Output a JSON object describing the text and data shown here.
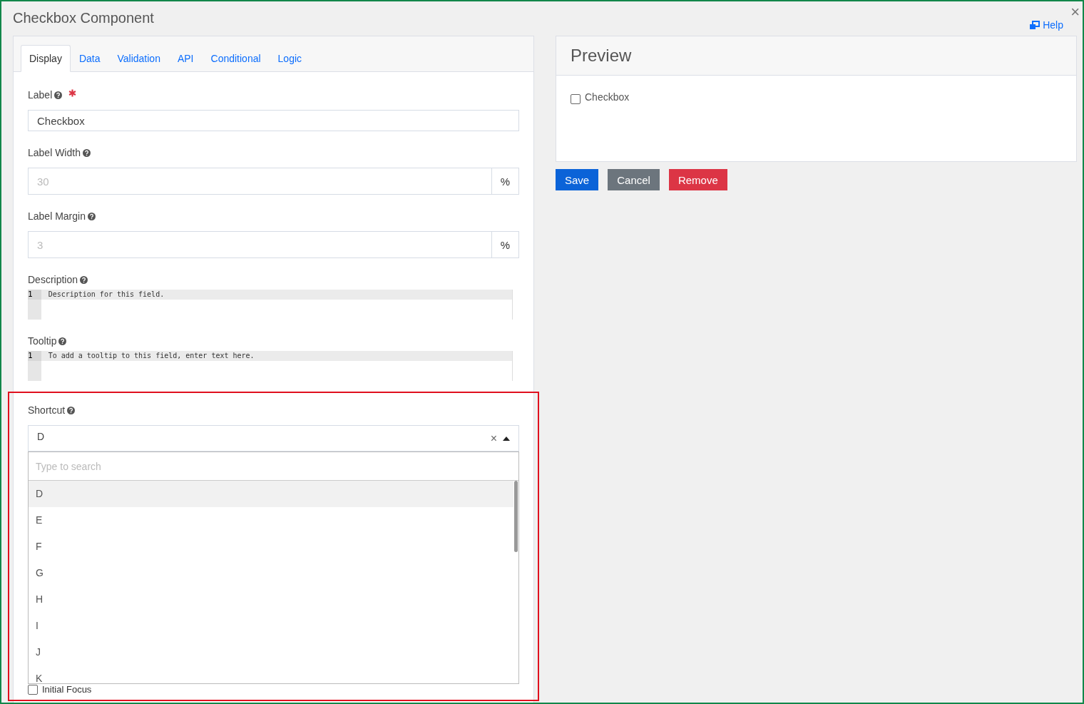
{
  "dialog": {
    "title": "Checkbox Component",
    "help_link": "Help",
    "close": "×"
  },
  "tabs": [
    {
      "label": "Display",
      "selected": true
    },
    {
      "label": "Data",
      "selected": false
    },
    {
      "label": "Validation",
      "selected": false
    },
    {
      "label": "API",
      "selected": false
    },
    {
      "label": "Conditional",
      "selected": false
    },
    {
      "label": "Logic",
      "selected": false
    }
  ],
  "fields": [
    {
      "kind": "text",
      "label": "Label",
      "required": true,
      "value": "Checkbox"
    },
    {
      "kind": "addon",
      "label": "Label Width",
      "required": false,
      "placeholder": "30",
      "addon": "%"
    },
    {
      "kind": "addon",
      "label": "Label Margin",
      "required": false,
      "placeholder": "3",
      "addon": "%"
    },
    {
      "kind": "code",
      "label": "Description",
      "required": false,
      "line_number": "1",
      "code": "Description for this field."
    },
    {
      "kind": "code",
      "label": "Tooltip",
      "required": false,
      "line_number": "1",
      "code": "To add a tooltip to this field, enter text here."
    }
  ],
  "shortcut": {
    "label": "Shortcut",
    "value": "D",
    "clear": "×",
    "search_placeholder": "Type to search",
    "options": [
      {
        "label": "D",
        "selected": true
      },
      {
        "label": "E",
        "selected": false
      },
      {
        "label": "F",
        "selected": false
      },
      {
        "label": "G",
        "selected": false
      },
      {
        "label": "H",
        "selected": false
      },
      {
        "label": "I",
        "selected": false
      },
      {
        "label": "J",
        "selected": false
      },
      {
        "label": "K",
        "selected": false
      }
    ]
  },
  "initial_focus": {
    "label": "Initial Focus",
    "checked": false
  },
  "preview": {
    "title": "Preview",
    "checkbox": {
      "label": "Checkbox",
      "checked": false
    }
  },
  "buttons": [
    {
      "label": "Save",
      "kind": "primary"
    },
    {
      "label": "Cancel",
      "kind": "secondary"
    },
    {
      "label": "Remove",
      "kind": "danger"
    }
  ]
}
